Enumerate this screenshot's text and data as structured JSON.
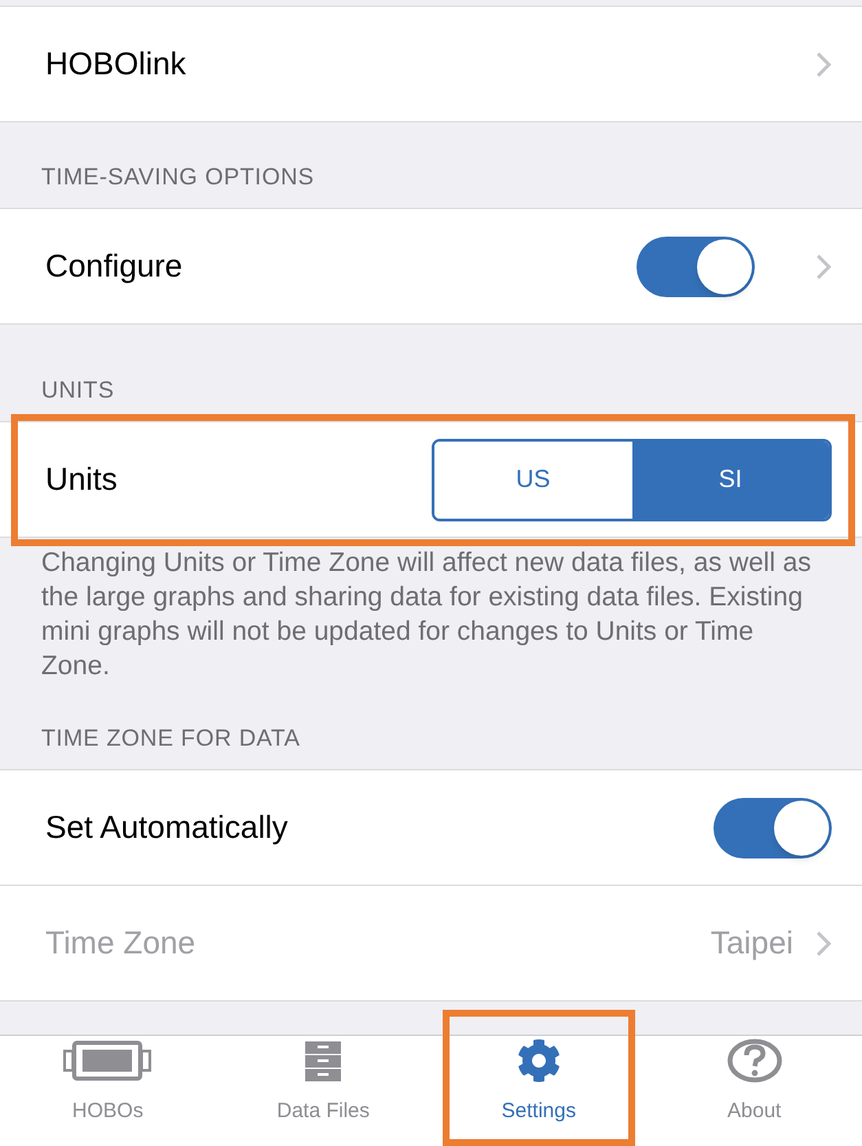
{
  "sections": [
    {
      "items": [
        {
          "kind": "link",
          "label": "HOBOlink"
        }
      ]
    },
    {
      "header": "TIME-SAVING OPTIONS",
      "items": [
        {
          "kind": "toggle-link",
          "label": "Configure",
          "on": true
        }
      ]
    },
    {
      "header": "UNITS",
      "items": [
        {
          "kind": "segmented",
          "label": "Units",
          "highlighted": true,
          "options": [
            {
              "label": "US",
              "selected": false
            },
            {
              "label": "SI",
              "selected": true
            }
          ]
        }
      ],
      "footer": "Changing Units or Time Zone will affect new data files, as well as the large graphs and sharing data for existing data files. Existing mini graphs will not be updated for changes to Units or Time Zone."
    },
    {
      "header": "TIME ZONE FOR DATA",
      "items": [
        {
          "kind": "toggle",
          "label": "Set Automatically",
          "on": true
        },
        {
          "kind": "link",
          "label": "Time Zone",
          "value": "Taipei",
          "disabled": true
        }
      ]
    }
  ],
  "tabs": [
    {
      "label": "HOBOs",
      "kind": "device",
      "selected": false,
      "highlighted": false
    },
    {
      "label": "Data Files",
      "kind": "cabinet",
      "selected": false,
      "highlighted": false
    },
    {
      "label": "Settings",
      "kind": "gear",
      "selected": true,
      "highlighted": true
    },
    {
      "label": "About",
      "kind": "help",
      "selected": false,
      "highlighted": false
    }
  ]
}
